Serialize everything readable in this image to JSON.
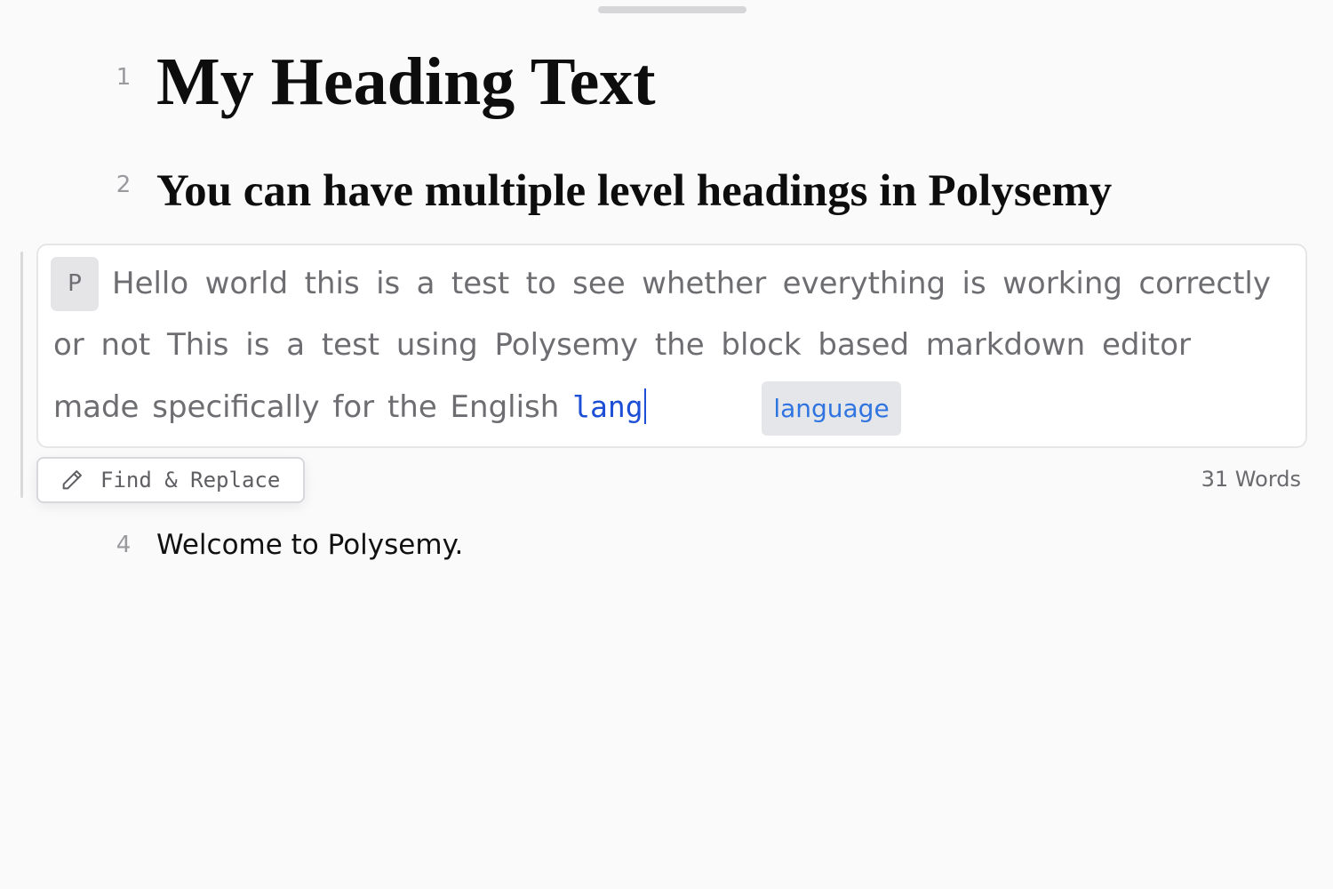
{
  "editor": {
    "blocks": [
      {
        "line": "1",
        "type": "heading-1",
        "text": "My Heading Text"
      },
      {
        "line": "2",
        "type": "heading-2",
        "text": "You can have multiple level headings in Polysemy"
      },
      {
        "line": "4",
        "type": "paragraph",
        "text": "Welcome to Polysemy."
      }
    ],
    "active_block": {
      "type_badge": "P",
      "lines": [
        "Hello world this is a test to see whether everything is working correctly",
        "or not This is a test using Polysemy the block based markdown editor",
        "made specifically for the English"
      ],
      "current_word": "lang",
      "suggestion": "language"
    },
    "toolbar": {
      "find_replace_label": "Find & Replace",
      "word_count": "31 Words"
    }
  },
  "colors": {
    "accent": "#1d4fd6",
    "suggestion_text": "#2f74e0",
    "background": "#fafafa"
  },
  "icons": {
    "find_replace": "pencil-icon"
  }
}
